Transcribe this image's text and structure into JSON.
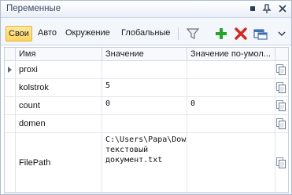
{
  "panel": {
    "title": "Переменные",
    "title_buttons": [
      {
        "name": "square-icon",
        "glyph": "▪"
      },
      {
        "name": "pin-icon",
        "glyph": "⊥"
      },
      {
        "name": "close-icon",
        "glyph": "×"
      }
    ]
  },
  "toolbar": {
    "tabs": [
      "Свои",
      "Авто",
      "Окружение",
      "Глобальные"
    ],
    "active_tab": "Свои",
    "accent_color": "#ffd45e",
    "buttons": [
      {
        "name": "filter-icon"
      },
      {
        "name": "add-icon",
        "color": "#2aa12a"
      },
      {
        "name": "delete-icon",
        "color": "#d4281c"
      },
      {
        "name": "window-icon"
      },
      {
        "name": "chevron-down-icon"
      }
    ]
  },
  "grid": {
    "columns": [
      "Имя",
      "Значение",
      "Значение по-умол..."
    ],
    "rows": [
      {
        "name": "proxi",
        "value": "",
        "default": "",
        "current": true
      },
      {
        "name": "kolstrok",
        "value": "5",
        "default": "",
        "current": false
      },
      {
        "name": "count",
        "value": "0",
        "default": "0",
        "current": false
      },
      {
        "name": "domen",
        "value": "",
        "default": "",
        "current": false
      },
      {
        "name": "FilePath",
        "value": "C:\\Users\\Papa\\Downloads\\Новый текстовый документ.txt",
        "default": "",
        "current": false
      }
    ]
  }
}
